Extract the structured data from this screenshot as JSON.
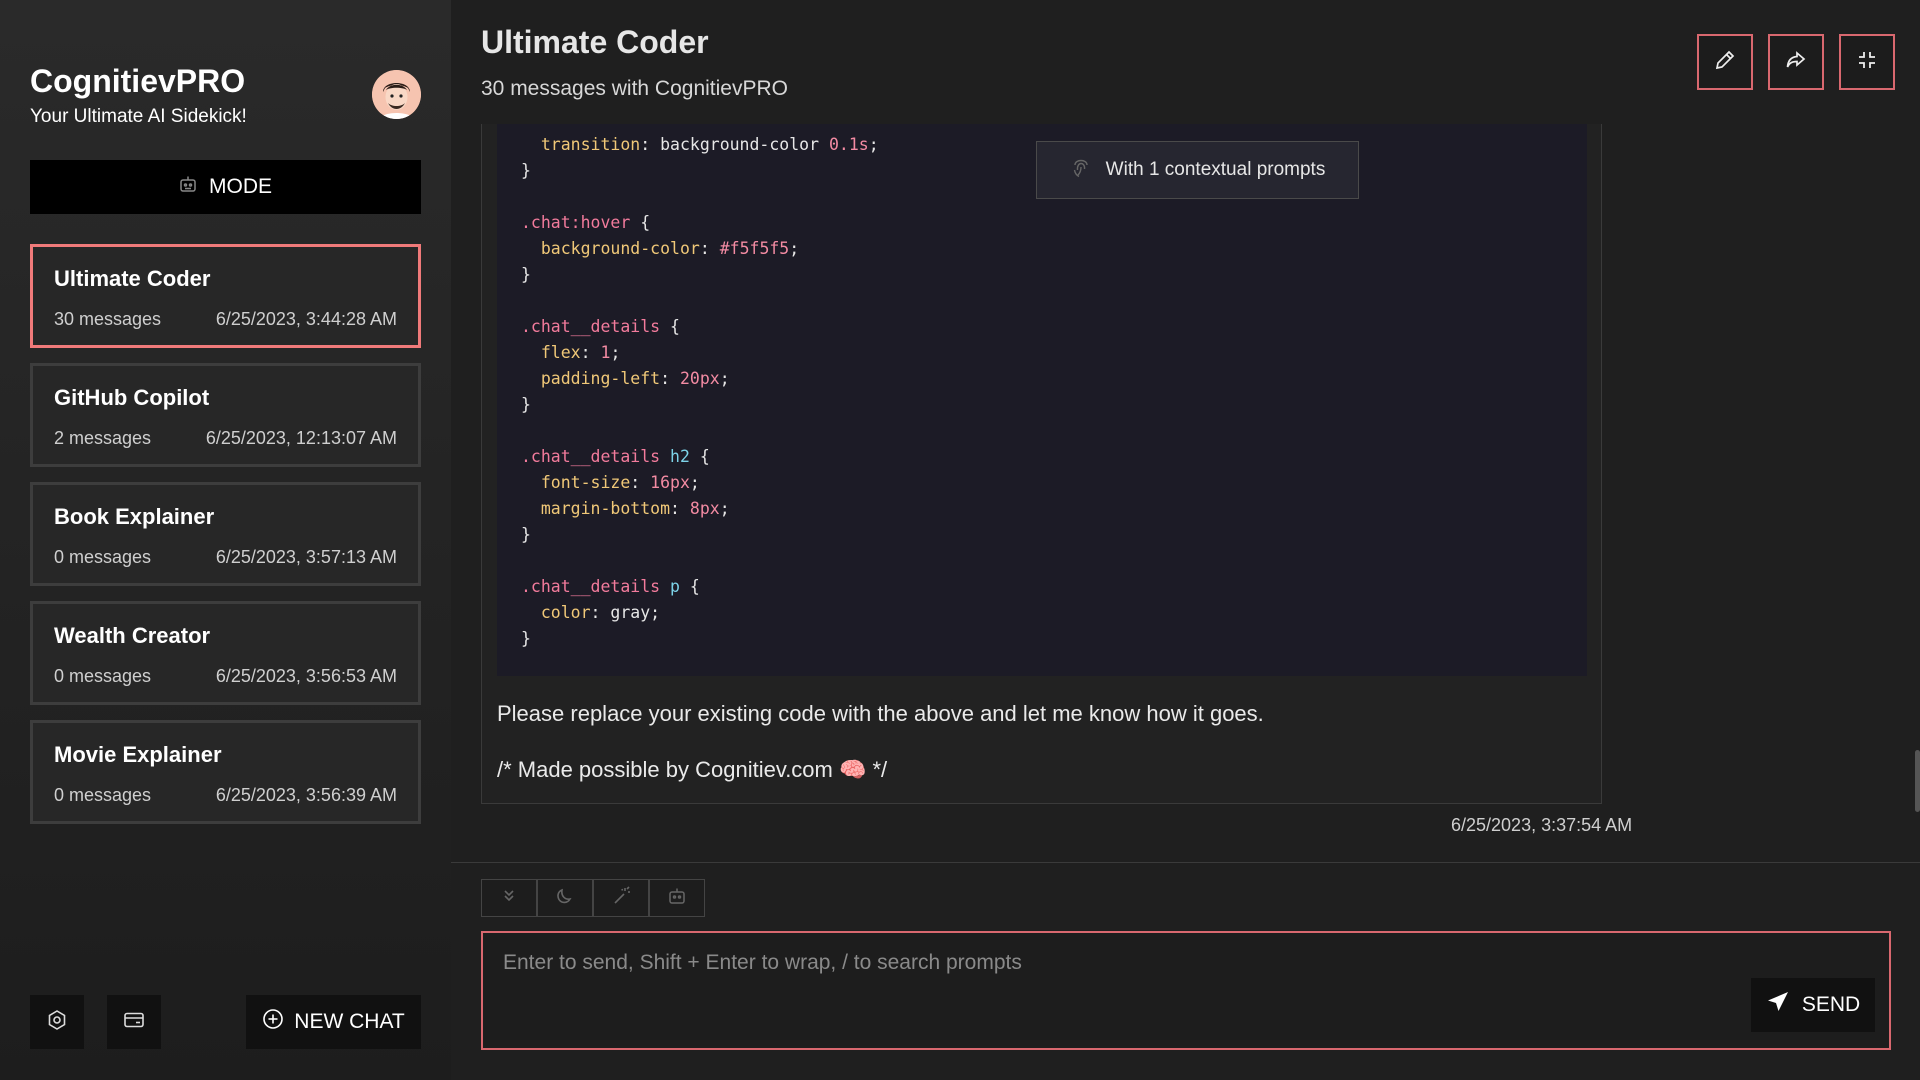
{
  "sidebar": {
    "brand_title": "CognitievPRO",
    "brand_subtitle": "Your Ultimate AI Sidekick!",
    "mode_label": "MODE",
    "new_chat_label": "NEW CHAT",
    "chats": [
      {
        "name": "Ultimate Coder",
        "count": "30 messages",
        "date": "6/25/2023, 3:44:28 AM",
        "active": true
      },
      {
        "name": "GitHub Copilot",
        "count": "2 messages",
        "date": "6/25/2023, 12:13:07 AM",
        "active": false
      },
      {
        "name": "Book Explainer",
        "count": "0 messages",
        "date": "6/25/2023, 3:57:13 AM",
        "active": false
      },
      {
        "name": "Wealth Creator",
        "count": "0 messages",
        "date": "6/25/2023, 3:56:53 AM",
        "active": false
      },
      {
        "name": "Movie Explainer",
        "count": "0 messages",
        "date": "6/25/2023, 3:56:39 AM",
        "active": false
      }
    ]
  },
  "header": {
    "title": "Ultimate Coder",
    "subtitle": "30 messages with CognitievPRO"
  },
  "message": {
    "context_badge": "With 1 contextual prompts",
    "code_lines": [
      [
        [
          "",
          "  "
        ],
        [
          "prop",
          "transition"
        ],
        [
          "",
          ": background-color "
        ],
        [
          "num",
          "0.1s"
        ],
        [
          "",
          ";"
        ]
      ],
      [
        [
          "",
          "}"
        ]
      ],
      [
        [
          "",
          ""
        ]
      ],
      [
        [
          "sel",
          ".chat:hover"
        ],
        [
          "",
          " {"
        ]
      ],
      [
        [
          "",
          "  "
        ],
        [
          "prop",
          "background-color"
        ],
        [
          "",
          ": "
        ],
        [
          "num",
          "#f5f5f5"
        ],
        [
          "",
          ";"
        ]
      ],
      [
        [
          "",
          "}"
        ]
      ],
      [
        [
          "",
          ""
        ]
      ],
      [
        [
          "sel",
          ".chat__details"
        ],
        [
          "",
          " {"
        ]
      ],
      [
        [
          "",
          "  "
        ],
        [
          "prop",
          "flex"
        ],
        [
          "",
          ": "
        ],
        [
          "num",
          "1"
        ],
        [
          "",
          ";"
        ]
      ],
      [
        [
          "",
          "  "
        ],
        [
          "prop",
          "padding-left"
        ],
        [
          "",
          ": "
        ],
        [
          "num",
          "20px"
        ],
        [
          "",
          ";"
        ]
      ],
      [
        [
          "",
          "}"
        ]
      ],
      [
        [
          "",
          ""
        ]
      ],
      [
        [
          "sel",
          ".chat__details"
        ],
        [
          "",
          " "
        ],
        [
          "tag",
          "h2"
        ],
        [
          "",
          " {"
        ]
      ],
      [
        [
          "",
          "  "
        ],
        [
          "prop",
          "font-size"
        ],
        [
          "",
          ": "
        ],
        [
          "num",
          "16px"
        ],
        [
          "",
          ";"
        ]
      ],
      [
        [
          "",
          "  "
        ],
        [
          "prop",
          "margin-bottom"
        ],
        [
          "",
          ": "
        ],
        [
          "num",
          "8px"
        ],
        [
          "",
          ";"
        ]
      ],
      [
        [
          "",
          "}"
        ]
      ],
      [
        [
          "",
          ""
        ]
      ],
      [
        [
          "sel",
          ".chat__details"
        ],
        [
          "",
          " "
        ],
        [
          "tag",
          "p"
        ],
        [
          "",
          " {"
        ]
      ],
      [
        [
          "",
          "  "
        ],
        [
          "prop",
          "color"
        ],
        [
          "",
          ": gray;"
        ]
      ],
      [
        [
          "",
          "}"
        ]
      ]
    ],
    "text_1": "Please replace your existing code with the above and let me know how it goes.",
    "text_2": "/* Made possible by Cognitiev.com 🧠 */",
    "timestamp": "6/25/2023, 3:37:54 AM"
  },
  "input": {
    "placeholder": "Enter to send, Shift + Enter to wrap, / to search prompts",
    "send_label": "SEND"
  },
  "colors": {
    "accent": "#d9686f",
    "active_border": "#f07a7a",
    "code_bg": "#1c1b26"
  }
}
